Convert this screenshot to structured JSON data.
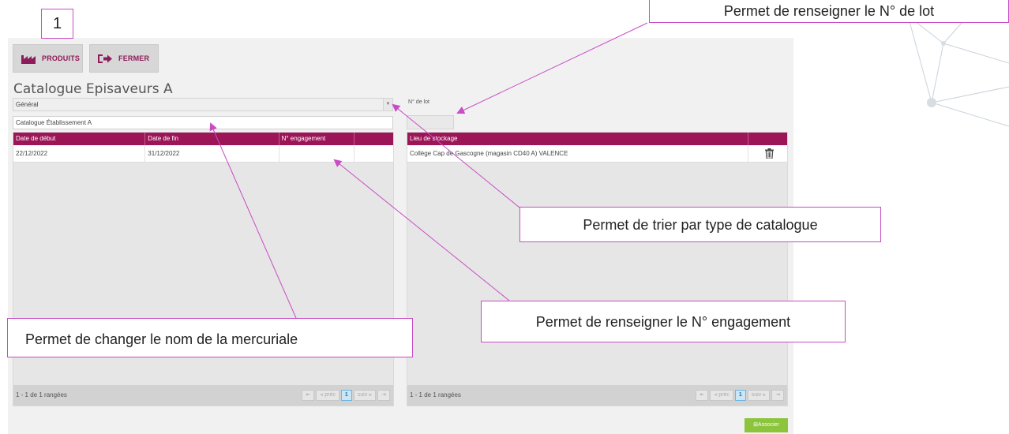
{
  "toolbar": {
    "produits_label": "PRODUITS",
    "fermer_label": "FERMER"
  },
  "page": {
    "title": "Catalogue Episaveurs A"
  },
  "filters": {
    "catalogue_type": "Général",
    "catalogue_name": "Catalogue Établissement A",
    "lot_label": "N° de lot",
    "lot_value": ""
  },
  "left_grid": {
    "columns": [
      "Date de début",
      "Date de fin",
      "N° engagement",
      ""
    ],
    "rows": [
      [
        "22/12/2022",
        "31/12/2022",
        "",
        ""
      ]
    ],
    "footer": "1 - 1 de 1 rangées"
  },
  "right_grid": {
    "columns": [
      "Lieu de stockage",
      ""
    ],
    "rows": [
      [
        "Collège Cap de Gascogne (magasin CD40 A) VALENCE",
        ""
      ]
    ],
    "footer": "1 - 1 de 1 rangées"
  },
  "pager": {
    "first": "⇤",
    "prev": "⫷ préc",
    "current": "1",
    "next": "suiv ⫸",
    "last": "⇥"
  },
  "associer_label": "Associer",
  "annotations": {
    "number": "1",
    "lot": "Permet de renseigner le N° de lot",
    "trier": "Permet de trier par type de catalogue",
    "engagement": "Permet de renseigner le N° engagement",
    "nom": "Permet de changer le nom de la mercuriale"
  },
  "colors": {
    "header_bar": "#9c1557",
    "callout_border": "#c84cc4",
    "associer": "#8cc43c"
  }
}
